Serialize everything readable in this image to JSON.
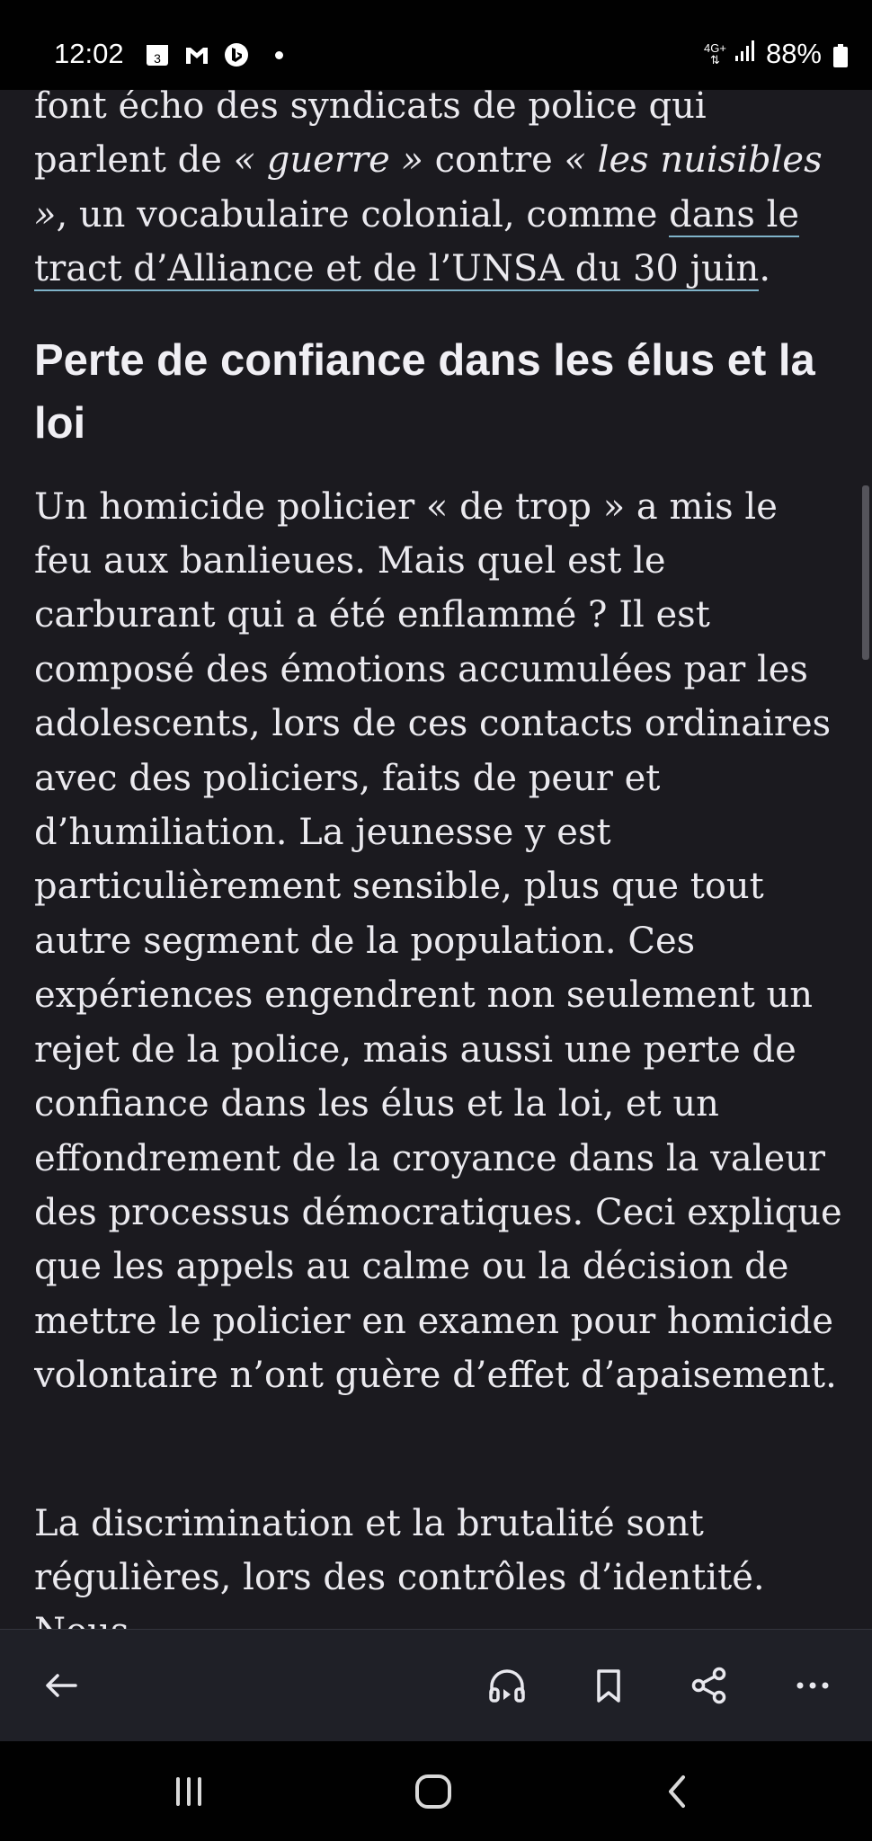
{
  "status_bar": {
    "time": "12:02",
    "calendar_badge": "3",
    "network": "4G+",
    "battery": "88%",
    "icons": [
      "calendar-icon",
      "gmail-icon",
      "bing-icon",
      "signal-icon",
      "battery-icon"
    ]
  },
  "article": {
    "p1": {
      "t1": "font écho des syndicats de police qui parlent de ",
      "t2": "« guerre »",
      "t3": " contre ",
      "t4": "« les nuisibles »",
      "t5": ", un vocabulaire colonial, comme ",
      "link": "dans le tract d’Alliance et de l’UNSA du 30 juin",
      "t6": "."
    },
    "heading": "Perte de confiance dans les élus et la loi",
    "p2": "Un homicide policier « de trop » a mis le feu aux banlieues. Mais quel est le carburant qui a été enflammé ? Il est composé des émotions accumulées par les adolescents, lors de ces contacts ordinaires avec des policiers, faits de peur et d’humiliation. La jeunesse y est particulièrement sensible, plus que tout autre segment de la population. Ces expériences engendrent non seulement un rejet de la police, mais aussi une perte de confiance dans les élus et la loi, et un effondrement de la croyance dans la valeur des processus démocratiques. Ceci explique que les appels au calme ou la décision de mettre le policier en examen pour homicide volontaire n’ont guère d’effet d’apaisement.",
    "p3": "La discrimination et la brutalité sont régulières, lors des contrôles d’identité. Nous"
  },
  "action_bar": {
    "icons": [
      "back-arrow-icon",
      "headphones-icon",
      "bookmark-icon",
      "share-icon",
      "more-icon"
    ]
  },
  "nav_bar": {
    "icons": [
      "recents-icon",
      "home-icon",
      "back-icon"
    ]
  },
  "colors": {
    "background": "#1b1a1f",
    "text": "#ebeaef",
    "link_underline": "#7fb3c9",
    "action_bar": "#1f2027",
    "system_bar": "#010101"
  }
}
